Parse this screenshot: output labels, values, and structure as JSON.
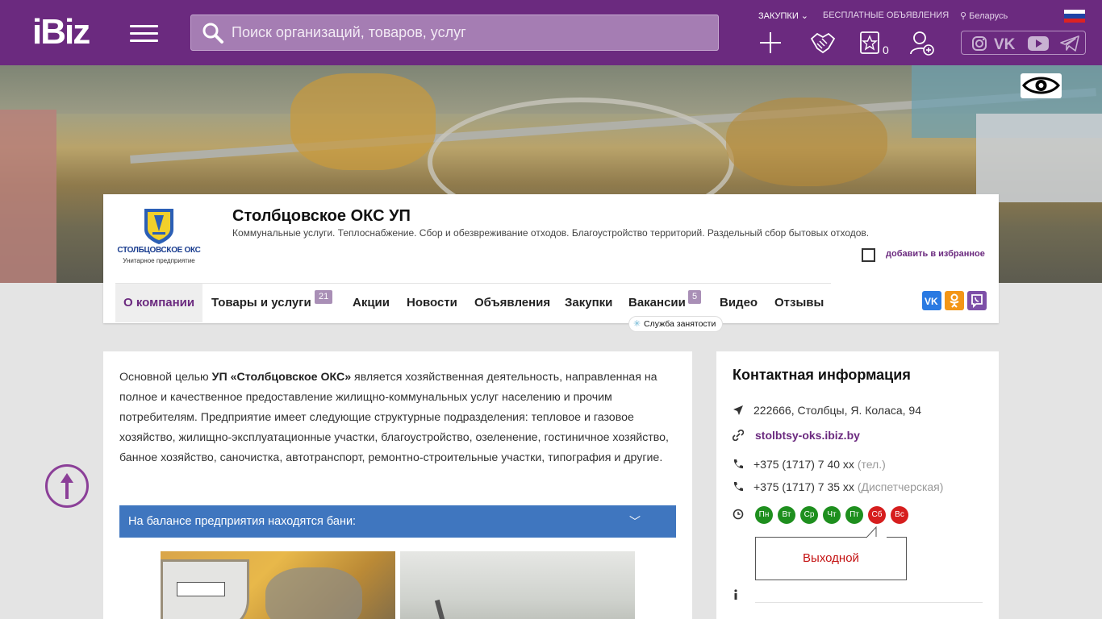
{
  "header": {
    "logo": "iBiz",
    "search_placeholder": "Поиск организаций, товаров, услуг",
    "links": {
      "purchases": "ЗАКУПКИ",
      "free_ads": "БЕСПЛАТНЫЕ ОБЪЯВЛЕНИЯ",
      "region": "Беларусь"
    },
    "favorites_count": "0",
    "icons": [
      "plus-icon",
      "handshake-icon",
      "star-icon",
      "add-user-icon"
    ],
    "social": [
      "instagram-icon",
      "vk-icon",
      "youtube-icon",
      "telegram-icon"
    ],
    "brand_color": "#6b2a7f"
  },
  "company": {
    "logo_caption": "СТОЛБЦОВСКОЕ ОКС",
    "logo_subcaption": "Унитарное предприятие",
    "title": "Столбцовское ОКС УП",
    "description": "Коммунальные услуги. Теплоснабжение. Сбор и обезвреживание отходов. Благоустройство территорий. Раздельный сбор бытовых отходов.",
    "favorite_label": "добавить в избранное"
  },
  "nav": {
    "tabs": [
      {
        "label": "О компании"
      },
      {
        "label": "Товары и услуги",
        "badge": "21"
      },
      {
        "label": "Акции"
      },
      {
        "label": "Новости"
      },
      {
        "label": "Объявления"
      },
      {
        "label": "Закупки"
      },
      {
        "label": "Вакансии",
        "badge": "5"
      },
      {
        "label": "Видео"
      },
      {
        "label": "Отзывы"
      }
    ],
    "employment_tag": "Служба занятости"
  },
  "main": {
    "about_pre": "Основной целью ",
    "about_bold": "УП «Столбцовское ОКС»",
    "about_post": " является хозяйственная деятельность, направленная на полное и качественное предоставление жилищно-коммунальных услуг населению и прочим потребителям. Предприятие имеет следующие структурные подразделения: тепловое и газовое хозяйство, жилищно-эксплуатационные участки, благоустройство, озеленение, гостиничное хозяйство, банное хозяйство, саночистка, автотранспорт, ремонтно-строительные участки, типография и другие.",
    "accordion_title": "На балансе предприятия находятся бани:"
  },
  "contact": {
    "title": "Контактная информация",
    "address": "222666, Столбцы, Я. Коласа, 94",
    "site": "stolbtsy-oks.ibiz.by",
    "phone1": "+375 (1717) 7 40 xx",
    "phone1_note": "(тел.)",
    "phone2": "+375 (1717) 7 35 xx",
    "phone2_note": "(Диспетчерская)",
    "days": [
      {
        "label": "Пн",
        "status": "open"
      },
      {
        "label": "Вт",
        "status": "open"
      },
      {
        "label": "Ср",
        "status": "open"
      },
      {
        "label": "Чт",
        "status": "open"
      },
      {
        "label": "Пт",
        "status": "open"
      },
      {
        "label": "Сб",
        "status": "closed"
      },
      {
        "label": "Вс",
        "status": "closed"
      }
    ],
    "day_off_label": "Выходной"
  }
}
